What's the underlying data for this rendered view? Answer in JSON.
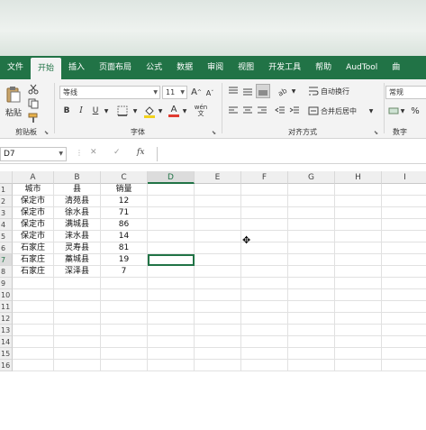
{
  "ribbon_tabs": [
    "文件",
    "开始",
    "插入",
    "页面布局",
    "公式",
    "数据",
    "审阅",
    "视图",
    "开发工具",
    "帮助",
    "AudTool",
    "曲"
  ],
  "active_tab": "开始",
  "clipboard": {
    "paste_label": "粘贴",
    "group_label": "剪贴板",
    "cut_icon": "scissors-icon",
    "copy_icon": "copy-icon",
    "format_painter_icon": "brush-icon"
  },
  "font": {
    "group_label": "字体",
    "font_name": "等线",
    "font_size": "11",
    "grow_label": "A",
    "shrink_label": "A",
    "bold_label": "B",
    "italic_label": "I",
    "underline_label": "U",
    "font_color_label": "A",
    "phonetic_label": "wén",
    "font_color": "#e03c31",
    "fill_color": "#f2d21b"
  },
  "alignment": {
    "group_label": "对齐方式",
    "wrap_text_label": "自动换行",
    "merge_center_label": "合并后居中"
  },
  "number": {
    "group_label": "数字",
    "format": "常规",
    "percent_label": "%"
  },
  "formula_bar": {
    "name_box": "D7",
    "cancel_label": "✕",
    "enter_label": "✓",
    "fx_label": "fx",
    "formula": ""
  },
  "sheet": {
    "columns": [
      "A",
      "B",
      "C",
      "D",
      "E",
      "F",
      "G",
      "H",
      "I"
    ],
    "row_numbers": [
      "1",
      "2",
      "3",
      "4",
      "5",
      "6",
      "7",
      "8",
      "9",
      "10",
      "11",
      "12",
      "13",
      "14",
      "15",
      "16"
    ],
    "rows": [
      [
        "城市",
        "县",
        "销量"
      ],
      [
        "保定市",
        "清苑县",
        "12"
      ],
      [
        "保定市",
        "徐水县",
        "71"
      ],
      [
        "保定市",
        "满城县",
        "86"
      ],
      [
        "保定市",
        "涞水县",
        "14"
      ],
      [
        "石家庄",
        "灵寿县",
        "81"
      ],
      [
        "石家庄",
        "藁城县",
        "19"
      ],
      [
        "石家庄",
        "深泽县",
        "7"
      ]
    ],
    "active_cell": "D7",
    "accent": "#217346"
  }
}
